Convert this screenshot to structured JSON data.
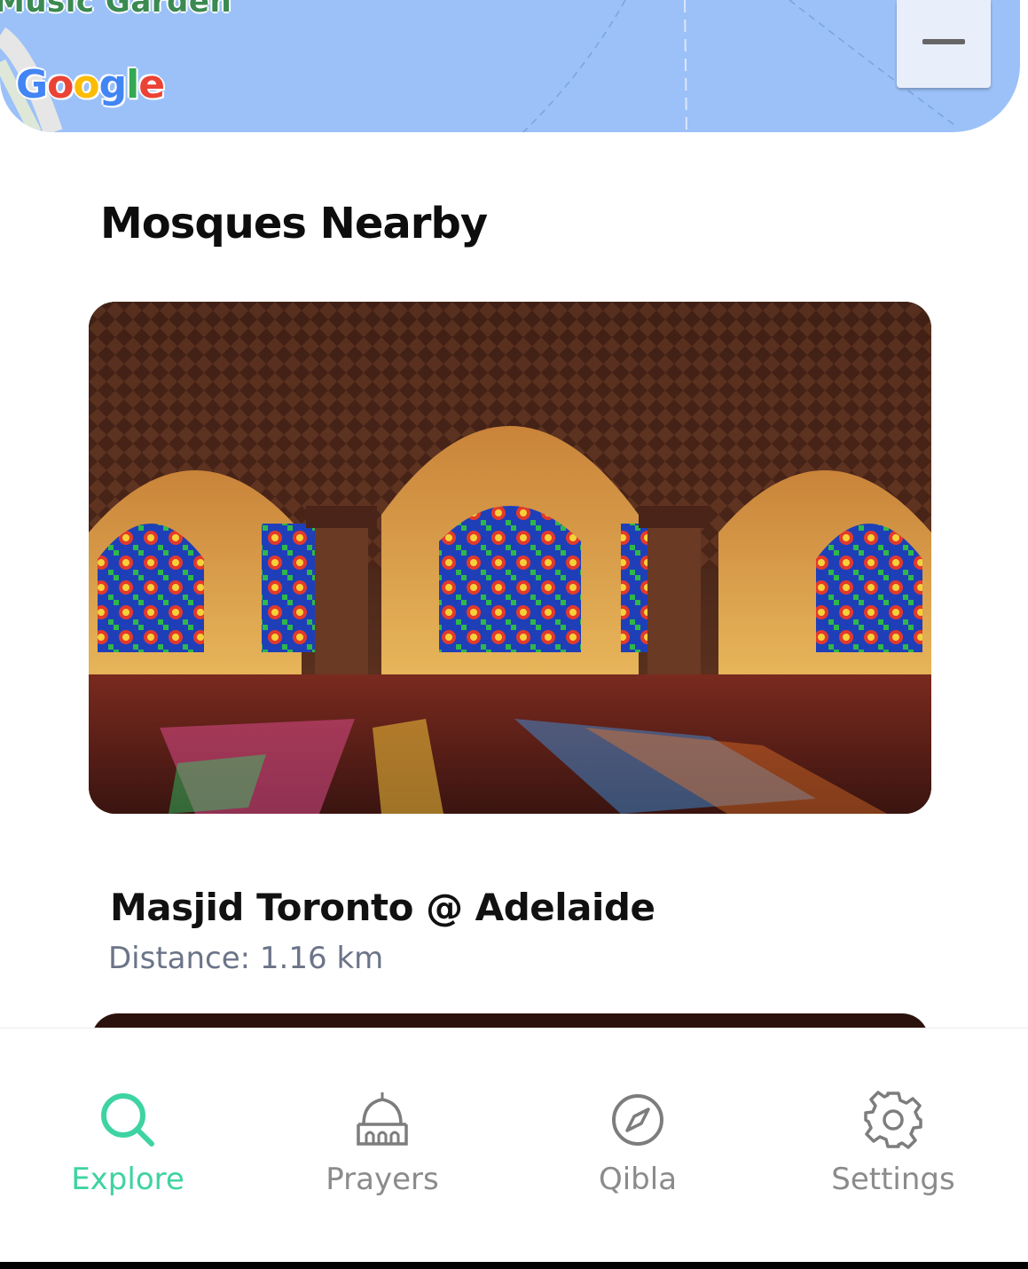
{
  "map": {
    "place_label": "Music Garden",
    "logo_letters": [
      "G",
      "o",
      "o",
      "g",
      "l",
      "e"
    ],
    "zoom_out_icon": "minus-icon"
  },
  "section": {
    "title": "Mosques Nearby"
  },
  "mosques": [
    {
      "name": "Masjid Toronto @ Adelaide",
      "distance": "Distance: 1.16 km"
    }
  ],
  "nav": {
    "items": [
      {
        "label": "Explore",
        "icon": "search-icon",
        "active": true
      },
      {
        "label": "Prayers",
        "icon": "mosque-icon",
        "active": false
      },
      {
        "label": "Qibla",
        "icon": "compass-icon",
        "active": false
      },
      {
        "label": "Settings",
        "icon": "gear-icon",
        "active": false
      }
    ],
    "active_color": "#3ed3a3",
    "inactive_color": "#8b8b8b"
  }
}
